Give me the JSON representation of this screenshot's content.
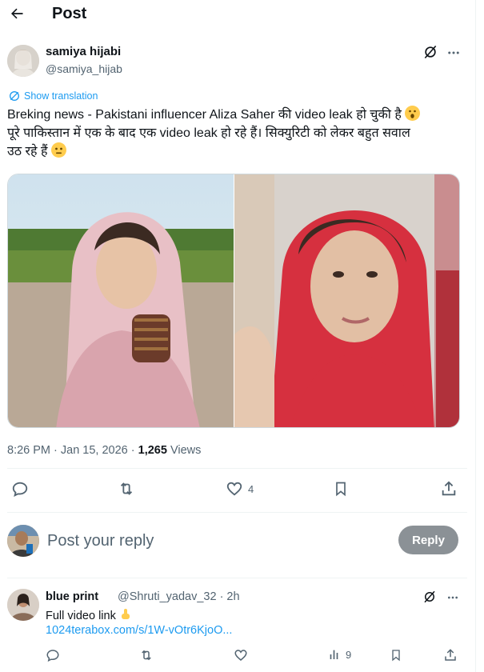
{
  "header": {
    "title": "Post"
  },
  "post": {
    "author_name": "samiya hijabi",
    "author_handle": "@samiya_hijab",
    "show_translation": "Show translation",
    "text_line1": "Breking news - Pakistani influencer Aliza Saher की video leak हो चुकी है",
    "text_line2": "पूरे पाकिस्तान में एक के बाद एक video leak हो रहे हैं। सिक्युरिटी को लेकर बहुत सवाल",
    "text_line3": "उठ रहे हैं",
    "time": "8:26 PM · Jan 15, 2026 · ",
    "views_count": "1,265",
    "views_label": " Views",
    "likes": "4"
  },
  "composer": {
    "placeholder": "Post your reply",
    "reply_label": "Reply"
  },
  "reply": {
    "name": "blue print",
    "handle": "@Shruti_yadav_32 · 2h",
    "text": "Full video link",
    "link": "1024terabox.com/s/1W-vOtr6KjoO...",
    "views": "9"
  },
  "colors": {
    "accent": "#1d9bf0",
    "text": "#0f1419",
    "muted": "#536471",
    "reply_button": "#8b9196"
  }
}
